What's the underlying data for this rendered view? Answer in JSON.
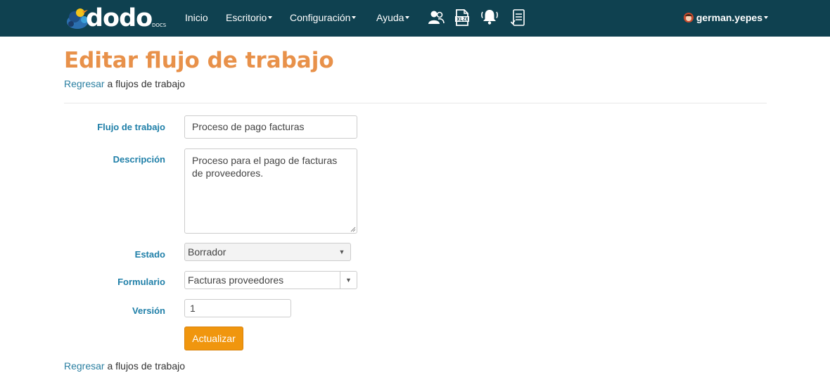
{
  "brand": {
    "name": "dodo",
    "sub": "DOCS"
  },
  "nav": {
    "items": [
      {
        "label": "Inicio"
      },
      {
        "label": "Escritorio"
      },
      {
        "label": "Configuración"
      },
      {
        "label": "Ayuda"
      }
    ],
    "icons": [
      "users-icon",
      "xlsx-file-icon",
      "notifications-bell-icon",
      "checklist-document-icon"
    ]
  },
  "user": {
    "name": "german.yepes"
  },
  "page": {
    "title": "Editar flujo de trabajo",
    "back_link": "Regresar",
    "back_suffix": " a flujos de trabajo"
  },
  "form": {
    "workflow": {
      "label": "Flujo de trabajo",
      "value": "Proceso de pago facturas"
    },
    "description": {
      "label": "Descripción",
      "value": "Proceso para el pago de facturas de proveedores."
    },
    "status": {
      "label": "Estado",
      "value": "Borrador"
    },
    "form_select": {
      "label": "Formulario",
      "value": "Facturas proveedores"
    },
    "version": {
      "label": "Versión",
      "value": "1"
    },
    "submit_label": "Actualizar"
  },
  "colors": {
    "topbar": "#0f4150",
    "title": "#e8914a",
    "label": "#1f7fa8",
    "link": "#2a7fa1",
    "button": "#f0960e"
  }
}
